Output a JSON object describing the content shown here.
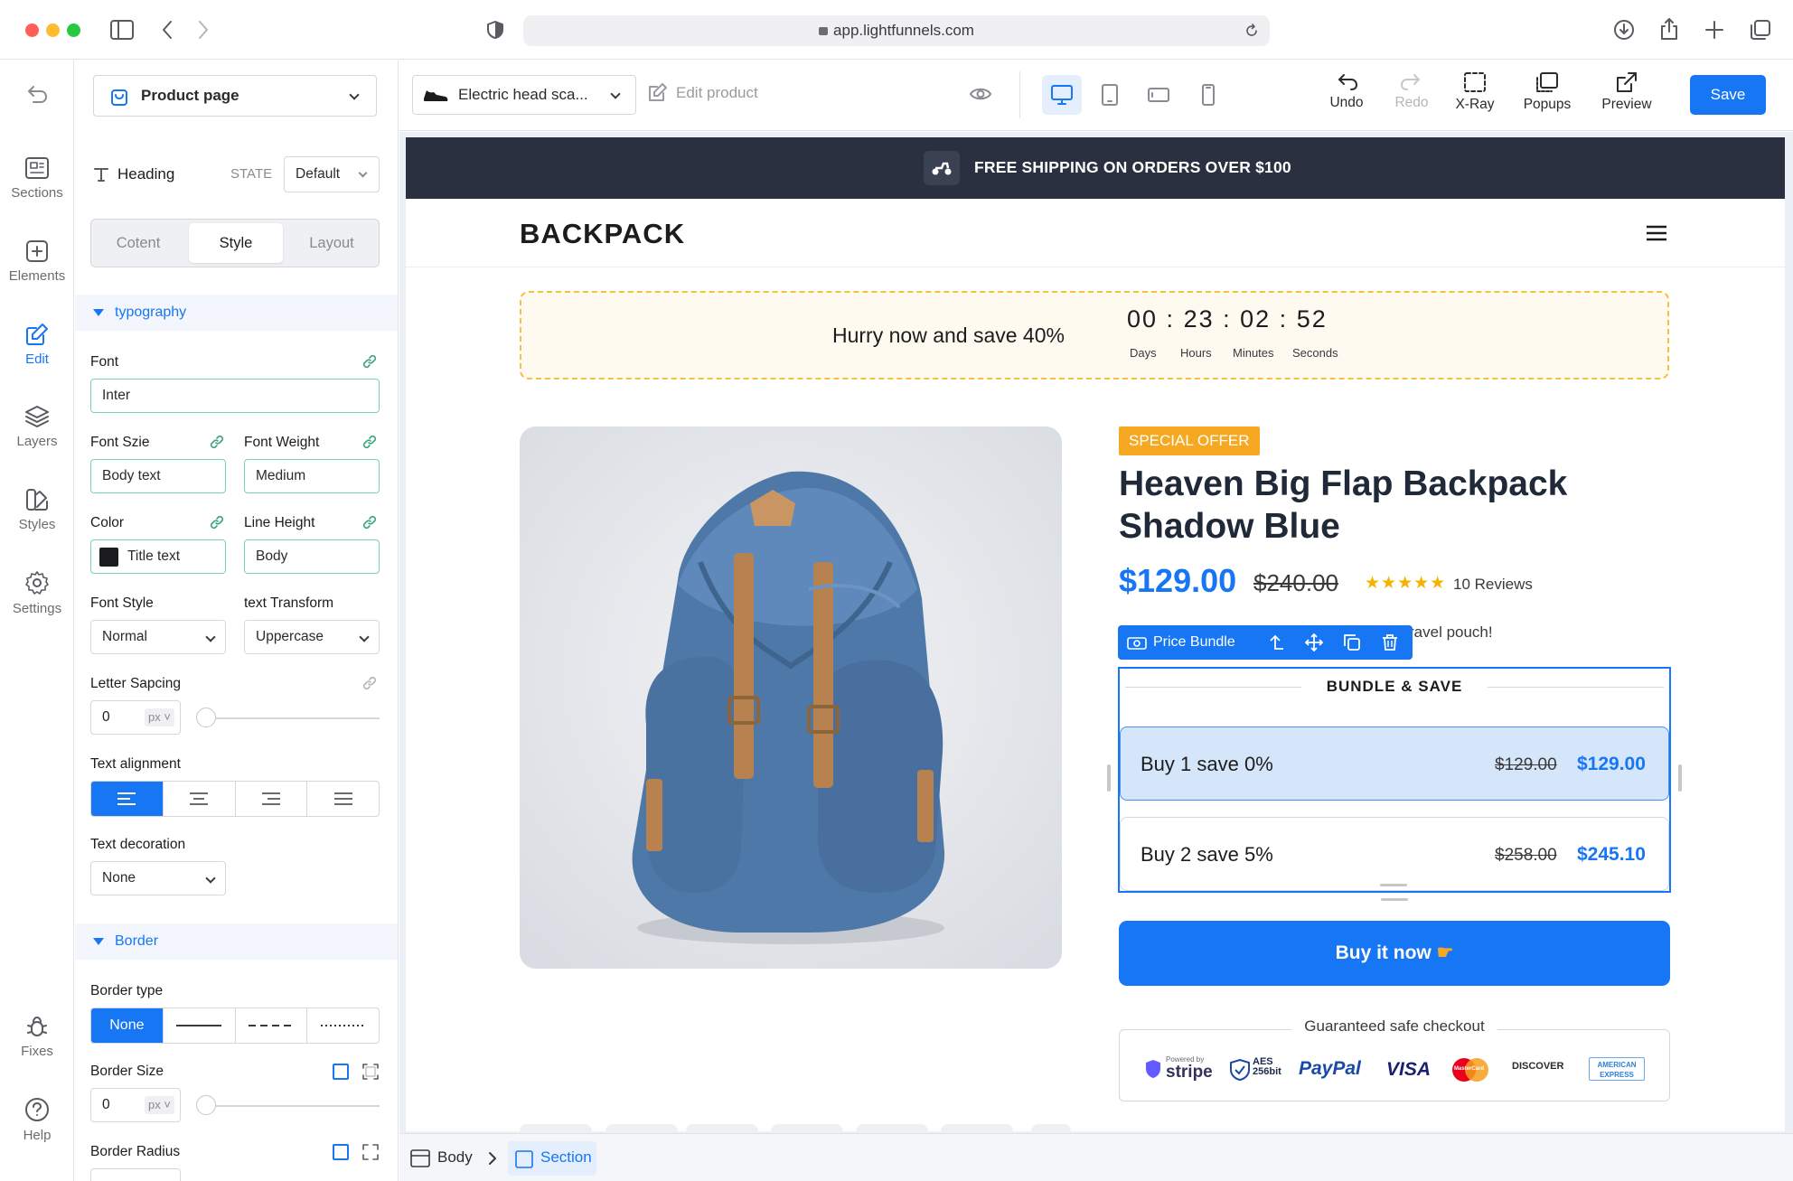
{
  "browser": {
    "url": "app.lightfunnels.com"
  },
  "rail": {
    "items": [
      {
        "label": "Sections"
      },
      {
        "label": "Elements"
      },
      {
        "label": "Edit"
      },
      {
        "label": "Layers"
      },
      {
        "label": "Styles"
      },
      {
        "label": "Settings"
      },
      {
        "label": "Fixes"
      },
      {
        "label": "Help"
      }
    ],
    "active": "Edit"
  },
  "panel": {
    "page_select": "Product page",
    "element_name": "Heading",
    "state_label": "STATE",
    "state_value": "Default",
    "tabs": [
      "Cotent",
      "Style",
      "Layout"
    ],
    "active_tab": "Style",
    "typography_title": "typography",
    "font_label": "Font",
    "font_value": "Inter",
    "font_size_label": "Font Szie",
    "font_size_value": "Body text",
    "font_weight_label": "Font Weight",
    "font_weight_value": "Medium",
    "color_label": "Color",
    "color_value": "Title text",
    "color_swatch": "#1c1c1e",
    "line_height_label": "Line Height",
    "line_height_value": "Body",
    "font_style_label": "Font Style",
    "font_style_value": "Normal",
    "text_transform_label": "text Transform",
    "text_transform_value": "Uppercase",
    "letter_spacing_label": "Letter Sapcing",
    "letter_spacing_value": "0",
    "unit": "px",
    "text_alignment_label": "Text alignment",
    "text_alignment_active": "left",
    "text_decoration_label": "Text decoration",
    "text_decoration_value": "None",
    "border_title": "Border",
    "border_type_label": "Border type",
    "border_type_none": "None",
    "border_size_label": "Border Size",
    "border_size_value": "0",
    "border_radius_label": "Border Radius"
  },
  "toolbar": {
    "product_select": "Electric head sca...",
    "edit_product": "Edit product",
    "undo": "Undo",
    "redo": "Redo",
    "xray": "X-Ray",
    "popups": "Popups",
    "preview": "Preview",
    "save": "Save"
  },
  "store": {
    "announcement": "FREE SHIPPING ON ORDERS OVER $100",
    "logo": "BACKPACK",
    "countdown_text": "Hurry now and save 40%",
    "countdown": {
      "days": "00",
      "hours": "23",
      "minutes": "02",
      "seconds": "52"
    },
    "countdown_labels": {
      "days": "Days",
      "hours": "Hours",
      "minutes": "Minutes",
      "seconds": "Seconds"
    },
    "badge": "SPECIAL OFFER",
    "product_title": "Heaven Big Flap Backpack Shadow Blue",
    "price": "$129.00",
    "compare_price": "$240.00",
    "rating": 5,
    "reviews": "10 Reviews",
    "partial_text": "ravel pouch!",
    "selection_label": "Price Bundle",
    "bundle_title": "BUNDLE & SAVE",
    "bundles": [
      {
        "label": "Buy 1 save 0%",
        "old": "$129.00",
        "price": "$129.00",
        "selected": true
      },
      {
        "label": "Buy 2 save 5%",
        "old": "$258.00",
        "price": "$245.10",
        "selected": false
      }
    ],
    "buy_button": "Buy it now",
    "checkout_title": "Guaranteed safe checkout",
    "payment_logos": [
      "stripe",
      "AES 256bit",
      "PayPal",
      "VISA",
      "MasterCard",
      "DISCOVER",
      "AMERICAN EXPRESS"
    ],
    "stripe_powered": "Powered by",
    "colors": {
      "accent": "#1676f3",
      "banner": "#2a3040",
      "badge": "#f7a823",
      "countdown_border": "#f4c141"
    }
  },
  "breadcrumb": {
    "items": [
      "Body",
      "Section"
    ]
  }
}
